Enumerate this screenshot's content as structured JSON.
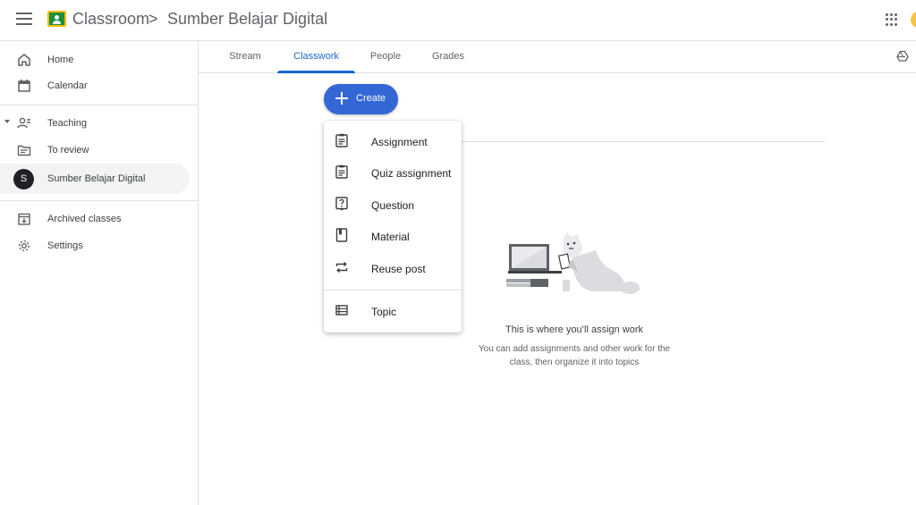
{
  "header": {
    "app_title": "Classroom",
    "breadcrumb_separator": ">",
    "class_title": "Sumber Belajar Digital"
  },
  "sidebar": {
    "items": [
      {
        "label": "Home",
        "icon": "home-icon"
      },
      {
        "label": "Calendar",
        "icon": "calendar-icon"
      },
      {
        "label": "Teaching",
        "icon": "teaching-icon"
      },
      {
        "label": "To review",
        "icon": "folder-icon"
      },
      {
        "label": "Sumber Belajar Digital",
        "icon": "class-avatar",
        "avatar_letter": "S",
        "active": true
      },
      {
        "label": "Archived classes",
        "icon": "archive-icon"
      },
      {
        "label": "Settings",
        "icon": "gear-icon"
      }
    ]
  },
  "tabs": {
    "items": [
      {
        "label": "Stream"
      },
      {
        "label": "Classwork",
        "active": true
      },
      {
        "label": "People"
      },
      {
        "label": "Grades"
      }
    ]
  },
  "create_button": {
    "label": "Create"
  },
  "create_menu": {
    "items": [
      {
        "label": "Assignment",
        "icon": "assignment-icon"
      },
      {
        "label": "Quiz assignment",
        "icon": "quiz-assignment-icon"
      },
      {
        "label": "Question",
        "icon": "question-icon"
      },
      {
        "label": "Material",
        "icon": "material-icon"
      },
      {
        "label": "Reuse post",
        "icon": "reuse-icon"
      },
      {
        "label": "Topic",
        "icon": "topic-icon"
      }
    ]
  },
  "empty_state": {
    "title": "This is where you’ll assign work",
    "description": "You can add assignments and other work for the class, then organize it into topics"
  },
  "colors": {
    "accent": "#1967d2",
    "create_button": "#3367d6",
    "logo_green": "#1e8e3e",
    "logo_yellow": "#fbbc04"
  }
}
